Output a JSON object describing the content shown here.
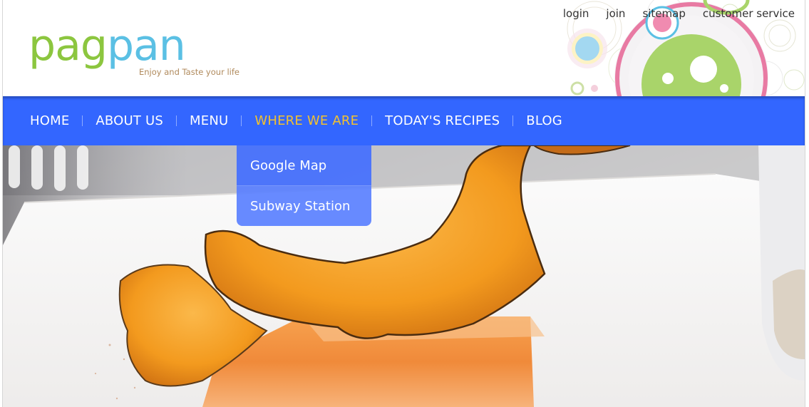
{
  "header": {
    "logo": {
      "part1": "pag",
      "part2": "pan"
    },
    "tagline": "Enjoy and Taste your life",
    "utility_links": [
      {
        "label": "login"
      },
      {
        "label": "join"
      },
      {
        "label": "sitemap"
      },
      {
        "label": "customer service"
      }
    ]
  },
  "nav": {
    "items": [
      {
        "label": "HOME"
      },
      {
        "label": "ABOUT US"
      },
      {
        "label": "MENU"
      },
      {
        "label": "WHERE WE ARE",
        "active": true
      },
      {
        "label": "TODAY'S RECIPES"
      },
      {
        "label": "BLOG"
      }
    ],
    "dropdown": [
      {
        "label": "Google Map"
      },
      {
        "label": "Subway Station"
      }
    ]
  },
  "colors": {
    "nav_bg": "#3366ff",
    "nav_active": "#f2c12e",
    "logo_green": "#8cc63f",
    "logo_blue": "#5bc0e4",
    "tagline": "#b08a5c"
  }
}
